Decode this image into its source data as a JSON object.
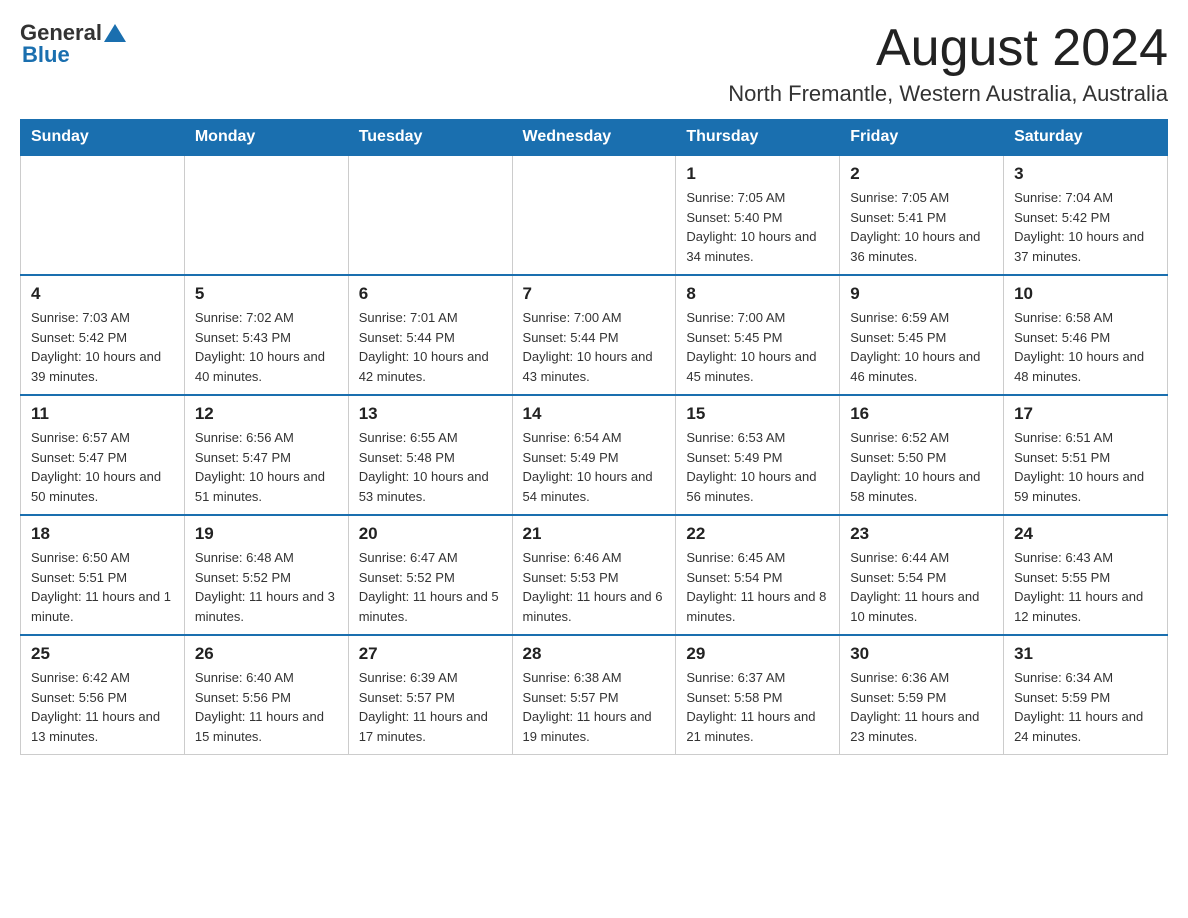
{
  "header": {
    "logo_general": "General",
    "logo_blue": "Blue",
    "month_title": "August 2024",
    "location": "North Fremantle, Western Australia, Australia"
  },
  "days_of_week": [
    "Sunday",
    "Monday",
    "Tuesday",
    "Wednesday",
    "Thursday",
    "Friday",
    "Saturday"
  ],
  "weeks": [
    [
      {
        "num": "",
        "info": ""
      },
      {
        "num": "",
        "info": ""
      },
      {
        "num": "",
        "info": ""
      },
      {
        "num": "",
        "info": ""
      },
      {
        "num": "1",
        "info": "Sunrise: 7:05 AM\nSunset: 5:40 PM\nDaylight: 10 hours and 34 minutes."
      },
      {
        "num": "2",
        "info": "Sunrise: 7:05 AM\nSunset: 5:41 PM\nDaylight: 10 hours and 36 minutes."
      },
      {
        "num": "3",
        "info": "Sunrise: 7:04 AM\nSunset: 5:42 PM\nDaylight: 10 hours and 37 minutes."
      }
    ],
    [
      {
        "num": "4",
        "info": "Sunrise: 7:03 AM\nSunset: 5:42 PM\nDaylight: 10 hours and 39 minutes."
      },
      {
        "num": "5",
        "info": "Sunrise: 7:02 AM\nSunset: 5:43 PM\nDaylight: 10 hours and 40 minutes."
      },
      {
        "num": "6",
        "info": "Sunrise: 7:01 AM\nSunset: 5:44 PM\nDaylight: 10 hours and 42 minutes."
      },
      {
        "num": "7",
        "info": "Sunrise: 7:00 AM\nSunset: 5:44 PM\nDaylight: 10 hours and 43 minutes."
      },
      {
        "num": "8",
        "info": "Sunrise: 7:00 AM\nSunset: 5:45 PM\nDaylight: 10 hours and 45 minutes."
      },
      {
        "num": "9",
        "info": "Sunrise: 6:59 AM\nSunset: 5:45 PM\nDaylight: 10 hours and 46 minutes."
      },
      {
        "num": "10",
        "info": "Sunrise: 6:58 AM\nSunset: 5:46 PM\nDaylight: 10 hours and 48 minutes."
      }
    ],
    [
      {
        "num": "11",
        "info": "Sunrise: 6:57 AM\nSunset: 5:47 PM\nDaylight: 10 hours and 50 minutes."
      },
      {
        "num": "12",
        "info": "Sunrise: 6:56 AM\nSunset: 5:47 PM\nDaylight: 10 hours and 51 minutes."
      },
      {
        "num": "13",
        "info": "Sunrise: 6:55 AM\nSunset: 5:48 PM\nDaylight: 10 hours and 53 minutes."
      },
      {
        "num": "14",
        "info": "Sunrise: 6:54 AM\nSunset: 5:49 PM\nDaylight: 10 hours and 54 minutes."
      },
      {
        "num": "15",
        "info": "Sunrise: 6:53 AM\nSunset: 5:49 PM\nDaylight: 10 hours and 56 minutes."
      },
      {
        "num": "16",
        "info": "Sunrise: 6:52 AM\nSunset: 5:50 PM\nDaylight: 10 hours and 58 minutes."
      },
      {
        "num": "17",
        "info": "Sunrise: 6:51 AM\nSunset: 5:51 PM\nDaylight: 10 hours and 59 minutes."
      }
    ],
    [
      {
        "num": "18",
        "info": "Sunrise: 6:50 AM\nSunset: 5:51 PM\nDaylight: 11 hours and 1 minute."
      },
      {
        "num": "19",
        "info": "Sunrise: 6:48 AM\nSunset: 5:52 PM\nDaylight: 11 hours and 3 minutes."
      },
      {
        "num": "20",
        "info": "Sunrise: 6:47 AM\nSunset: 5:52 PM\nDaylight: 11 hours and 5 minutes."
      },
      {
        "num": "21",
        "info": "Sunrise: 6:46 AM\nSunset: 5:53 PM\nDaylight: 11 hours and 6 minutes."
      },
      {
        "num": "22",
        "info": "Sunrise: 6:45 AM\nSunset: 5:54 PM\nDaylight: 11 hours and 8 minutes."
      },
      {
        "num": "23",
        "info": "Sunrise: 6:44 AM\nSunset: 5:54 PM\nDaylight: 11 hours and 10 minutes."
      },
      {
        "num": "24",
        "info": "Sunrise: 6:43 AM\nSunset: 5:55 PM\nDaylight: 11 hours and 12 minutes."
      }
    ],
    [
      {
        "num": "25",
        "info": "Sunrise: 6:42 AM\nSunset: 5:56 PM\nDaylight: 11 hours and 13 minutes."
      },
      {
        "num": "26",
        "info": "Sunrise: 6:40 AM\nSunset: 5:56 PM\nDaylight: 11 hours and 15 minutes."
      },
      {
        "num": "27",
        "info": "Sunrise: 6:39 AM\nSunset: 5:57 PM\nDaylight: 11 hours and 17 minutes."
      },
      {
        "num": "28",
        "info": "Sunrise: 6:38 AM\nSunset: 5:57 PM\nDaylight: 11 hours and 19 minutes."
      },
      {
        "num": "29",
        "info": "Sunrise: 6:37 AM\nSunset: 5:58 PM\nDaylight: 11 hours and 21 minutes."
      },
      {
        "num": "30",
        "info": "Sunrise: 6:36 AM\nSunset: 5:59 PM\nDaylight: 11 hours and 23 minutes."
      },
      {
        "num": "31",
        "info": "Sunrise: 6:34 AM\nSunset: 5:59 PM\nDaylight: 11 hours and 24 minutes."
      }
    ]
  ]
}
